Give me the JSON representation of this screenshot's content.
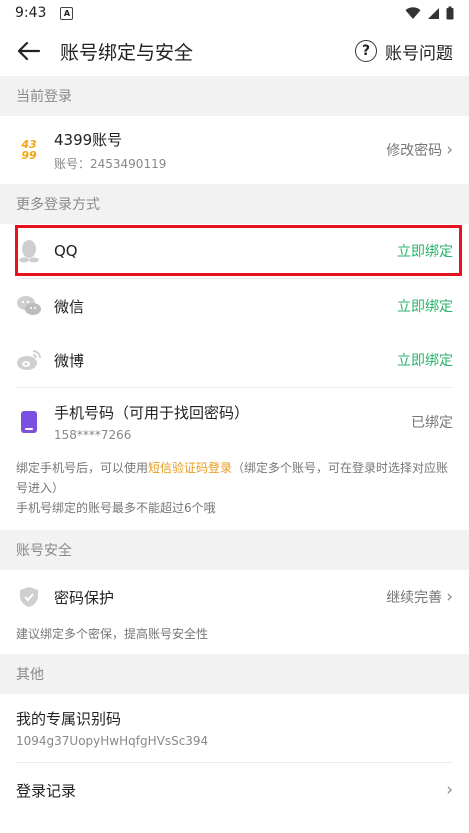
{
  "status": {
    "time": "9:43",
    "notif": "A"
  },
  "header": {
    "title": "账号绑定与安全",
    "help_label": "账号问题"
  },
  "current": {
    "section": "当前登录",
    "logo_top": "43",
    "logo_bottom": "99",
    "title": "4399账号",
    "account": "账号：2453490119",
    "action": "修改密码"
  },
  "more": {
    "section": "更多登录方式",
    "items": [
      {
        "label": "QQ",
        "action": "立即绑定"
      },
      {
        "label": "微信",
        "action": "立即绑定"
      },
      {
        "label": "微博",
        "action": "立即绑定"
      }
    ],
    "phone": {
      "label": "手机号码（可用于找回密码）",
      "number": "158****7266",
      "status": "已绑定"
    },
    "note_part1": "绑定手机号后，可以使用",
    "note_link": "短信验证码登录",
    "note_part2": "（绑定多个账号，可在登录时选择对应账号进入）",
    "note_line2": "手机号绑定的账号最多不能超过6个哦"
  },
  "security": {
    "section": "账号安全",
    "label": "密码保护",
    "action": "继续完善",
    "note": "建议绑定多个密保，提高账号安全性"
  },
  "other": {
    "section": "其他",
    "id_label": "我的专属识别码",
    "id_value": "1094g37UopyHwHqfgHVsSc394",
    "log_label": "登录记录"
  },
  "colors": {
    "accent_green": "#2ab36b",
    "highlight_red": "#e8121e",
    "link_orange": "#e79b1c"
  }
}
